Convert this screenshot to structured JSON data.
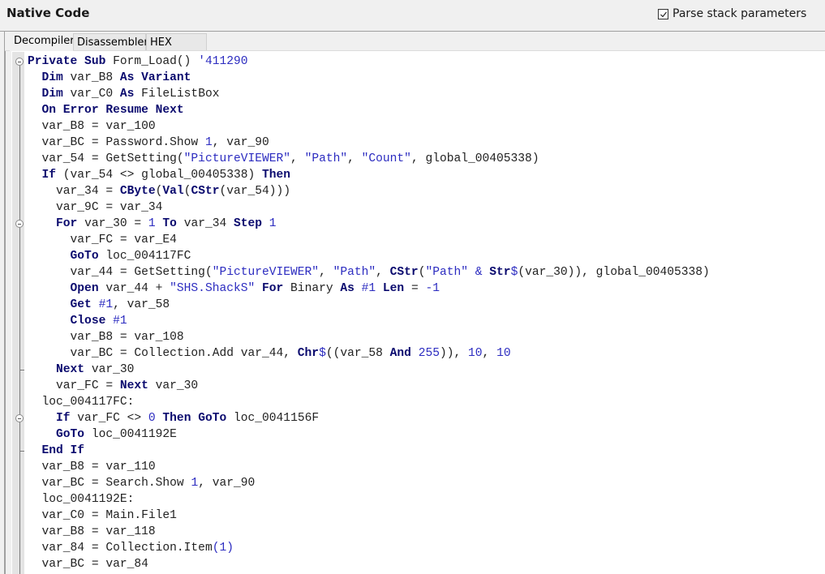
{
  "header": {
    "title": "Native Code",
    "parse_stack_checkbox": {
      "label": "Parse stack parameters",
      "checked": true
    }
  },
  "tabs": [
    {
      "label": "Decompiler",
      "active": true
    },
    {
      "label": "Disassembler",
      "active": false
    },
    {
      "label": "HEX Editor",
      "active": false
    }
  ],
  "icons": {
    "fold": "circle-minus-icon",
    "checkbox_check": "checkmark-icon"
  },
  "colors": {
    "keyword": "#0a0a6e",
    "literal": "#2c2cc0",
    "plain": "#222222",
    "editor_bg": "#ffffff",
    "chrome_bg": "#f0f0f0"
  },
  "code_lines": [
    {
      "indent": 0,
      "fold": true,
      "tokens": [
        {
          "t": "kw",
          "v": "Private Sub"
        },
        {
          "t": "plain",
          "v": " Form_Load() "
        },
        {
          "t": "cmt",
          "v": "'411290"
        }
      ]
    },
    {
      "indent": 1,
      "tokens": [
        {
          "t": "kw",
          "v": "Dim"
        },
        {
          "t": "plain",
          "v": " var_B8 "
        },
        {
          "t": "kw",
          "v": "As Variant"
        }
      ]
    },
    {
      "indent": 1,
      "tokens": [
        {
          "t": "kw",
          "v": "Dim"
        },
        {
          "t": "plain",
          "v": " var_C0 "
        },
        {
          "t": "kw",
          "v": "As"
        },
        {
          "t": "plain",
          "v": " FileListBox"
        }
      ]
    },
    {
      "indent": 1,
      "tokens": [
        {
          "t": "kw",
          "v": "On Error Resume Next"
        }
      ]
    },
    {
      "indent": 1,
      "tokens": [
        {
          "t": "plain",
          "v": "var_B8 = var_100"
        }
      ]
    },
    {
      "indent": 1,
      "tokens": [
        {
          "t": "plain",
          "v": "var_BC = Password.Show "
        },
        {
          "t": "num",
          "v": "1"
        },
        {
          "t": "plain",
          "v": ", var_90"
        }
      ]
    },
    {
      "indent": 1,
      "tokens": [
        {
          "t": "plain",
          "v": "var_54 = GetSetting("
        },
        {
          "t": "str",
          "v": "\"PictureVIEWER\""
        },
        {
          "t": "plain",
          "v": ", "
        },
        {
          "t": "str",
          "v": "\"Path\""
        },
        {
          "t": "plain",
          "v": ", "
        },
        {
          "t": "str",
          "v": "\"Count\""
        },
        {
          "t": "plain",
          "v": ", global_00405338)"
        }
      ]
    },
    {
      "indent": 1,
      "tokens": [
        {
          "t": "kw",
          "v": "If"
        },
        {
          "t": "plain",
          "v": " (var_54 <> global_00405338) "
        },
        {
          "t": "kw",
          "v": "Then"
        }
      ]
    },
    {
      "indent": 2,
      "tokens": [
        {
          "t": "plain",
          "v": "var_34 = "
        },
        {
          "t": "kw",
          "v": "CByte"
        },
        {
          "t": "plain",
          "v": "("
        },
        {
          "t": "kw",
          "v": "Val"
        },
        {
          "t": "plain",
          "v": "("
        },
        {
          "t": "kw",
          "v": "CStr"
        },
        {
          "t": "plain",
          "v": "(var_54)))"
        }
      ]
    },
    {
      "indent": 2,
      "tokens": [
        {
          "t": "plain",
          "v": "var_9C = var_34"
        }
      ]
    },
    {
      "indent": 2,
      "fold": true,
      "tokens": [
        {
          "t": "kw",
          "v": "For"
        },
        {
          "t": "plain",
          "v": " var_30 = "
        },
        {
          "t": "num",
          "v": "1"
        },
        {
          "t": "plain",
          "v": " "
        },
        {
          "t": "kw",
          "v": "To"
        },
        {
          "t": "plain",
          "v": " var_34 "
        },
        {
          "t": "kw",
          "v": "Step"
        },
        {
          "t": "plain",
          "v": " "
        },
        {
          "t": "num",
          "v": "1"
        }
      ]
    },
    {
      "indent": 3,
      "tokens": [
        {
          "t": "plain",
          "v": "var_FC = var_E4"
        }
      ]
    },
    {
      "indent": 3,
      "tokens": [
        {
          "t": "kw",
          "v": "GoTo"
        },
        {
          "t": "plain",
          "v": " loc_004117FC"
        }
      ]
    },
    {
      "indent": 3,
      "tokens": [
        {
          "t": "plain",
          "v": "var_44 = GetSetting("
        },
        {
          "t": "str",
          "v": "\"PictureVIEWER\""
        },
        {
          "t": "plain",
          "v": ", "
        },
        {
          "t": "str",
          "v": "\"Path\""
        },
        {
          "t": "plain",
          "v": ", "
        },
        {
          "t": "kw",
          "v": "CStr"
        },
        {
          "t": "plain",
          "v": "("
        },
        {
          "t": "str",
          "v": "\"Path\""
        },
        {
          "t": "plain",
          "v": " "
        },
        {
          "t": "op",
          "v": "&"
        },
        {
          "t": "plain",
          "v": " "
        },
        {
          "t": "kw",
          "v": "Str"
        },
        {
          "t": "op",
          "v": "$"
        },
        {
          "t": "plain",
          "v": "(var_30)), global_00405338)"
        }
      ]
    },
    {
      "indent": 3,
      "tokens": [
        {
          "t": "kw",
          "v": "Open"
        },
        {
          "t": "plain",
          "v": " var_44 + "
        },
        {
          "t": "str",
          "v": "\"SHS.ShackS\""
        },
        {
          "t": "plain",
          "v": " "
        },
        {
          "t": "kw",
          "v": "For"
        },
        {
          "t": "plain",
          "v": " Binary "
        },
        {
          "t": "kw",
          "v": "As"
        },
        {
          "t": "plain",
          "v": " "
        },
        {
          "t": "num",
          "v": "#1"
        },
        {
          "t": "plain",
          "v": " "
        },
        {
          "t": "kw",
          "v": "Len"
        },
        {
          "t": "plain",
          "v": " = "
        },
        {
          "t": "num",
          "v": "-1"
        }
      ]
    },
    {
      "indent": 3,
      "tokens": [
        {
          "t": "kw",
          "v": "Get"
        },
        {
          "t": "plain",
          "v": " "
        },
        {
          "t": "num",
          "v": "#1"
        },
        {
          "t": "plain",
          "v": ", var_58"
        }
      ]
    },
    {
      "indent": 3,
      "tokens": [
        {
          "t": "kw",
          "v": "Close"
        },
        {
          "t": "plain",
          "v": " "
        },
        {
          "t": "num",
          "v": "#1"
        }
      ]
    },
    {
      "indent": 3,
      "tokens": [
        {
          "t": "plain",
          "v": "var_B8 = var_108"
        }
      ]
    },
    {
      "indent": 3,
      "tokens": [
        {
          "t": "plain",
          "v": "var_BC = Collection.Add var_44, "
        },
        {
          "t": "kw",
          "v": "Chr"
        },
        {
          "t": "op",
          "v": "$"
        },
        {
          "t": "plain",
          "v": "((var_58 "
        },
        {
          "t": "kw",
          "v": "And"
        },
        {
          "t": "plain",
          "v": " "
        },
        {
          "t": "num",
          "v": "255"
        },
        {
          "t": "plain",
          "v": ")), "
        },
        {
          "t": "num",
          "v": "10"
        },
        {
          "t": "plain",
          "v": ", "
        },
        {
          "t": "num",
          "v": "10"
        }
      ]
    },
    {
      "indent": 2,
      "tokens": [
        {
          "t": "kw",
          "v": "Next"
        },
        {
          "t": "plain",
          "v": " var_30"
        }
      ]
    },
    {
      "indent": 2,
      "tokens": [
        {
          "t": "plain",
          "v": "var_FC = "
        },
        {
          "t": "kw",
          "v": "Next"
        },
        {
          "t": "plain",
          "v": " var_30"
        }
      ]
    },
    {
      "indent": 1,
      "tokens": [
        {
          "t": "plain",
          "v": "loc_004117FC:"
        }
      ]
    },
    {
      "indent": 2,
      "fold": true,
      "tokens": [
        {
          "t": "kw",
          "v": "If"
        },
        {
          "t": "plain",
          "v": " var_FC <> "
        },
        {
          "t": "num",
          "v": "0"
        },
        {
          "t": "plain",
          "v": " "
        },
        {
          "t": "kw",
          "v": "Then GoTo"
        },
        {
          "t": "plain",
          "v": " loc_0041156F"
        }
      ]
    },
    {
      "indent": 2,
      "tokens": [
        {
          "t": "kw",
          "v": "GoTo"
        },
        {
          "t": "plain",
          "v": " loc_0041192E"
        }
      ]
    },
    {
      "indent": 1,
      "tokens": [
        {
          "t": "kw",
          "v": "End If"
        }
      ]
    },
    {
      "indent": 1,
      "tokens": [
        {
          "t": "plain",
          "v": "var_B8 = var_110"
        }
      ]
    },
    {
      "indent": 1,
      "tokens": [
        {
          "t": "plain",
          "v": "var_BC = Search.Show "
        },
        {
          "t": "num",
          "v": "1"
        },
        {
          "t": "plain",
          "v": ", var_90"
        }
      ]
    },
    {
      "indent": 1,
      "tokens": [
        {
          "t": "plain",
          "v": "loc_0041192E:"
        }
      ]
    },
    {
      "indent": 1,
      "tokens": [
        {
          "t": "plain",
          "v": "var_C0 = Main.File1"
        }
      ]
    },
    {
      "indent": 1,
      "tokens": [
        {
          "t": "plain",
          "v": "var_B8 = var_118"
        }
      ]
    },
    {
      "indent": 1,
      "tokens": [
        {
          "t": "plain",
          "v": "var_84 = Collection.Item"
        },
        {
          "t": "num",
          "v": "(1)"
        }
      ]
    },
    {
      "indent": 1,
      "tokens": [
        {
          "t": "plain",
          "v": "var_BC = var_84"
        }
      ]
    }
  ]
}
